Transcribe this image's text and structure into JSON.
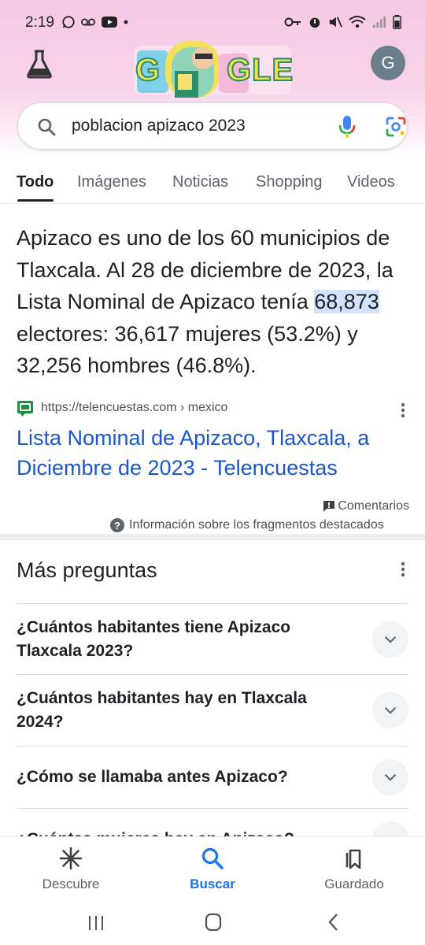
{
  "status_bar": {
    "time": "2:19",
    "left_icons": [
      "whatsapp-icon",
      "voicemail-icon",
      "youtube-icon",
      "dot-icon"
    ],
    "right_icons": [
      "key-icon",
      "alarm-icon",
      "mute-icon",
      "wifi-icon",
      "signal-icon",
      "battery-icon"
    ]
  },
  "header": {
    "labs_icon": "flask-icon",
    "doodle_text": "GLE",
    "avatar_letter": "G"
  },
  "search": {
    "query": "poblacion apizaco 2023"
  },
  "tabs": [
    "Todo",
    "Imágenes",
    "Noticias",
    "Shopping",
    "Videos"
  ],
  "featured_snippet": {
    "text_before": "Apizaco es uno de los 60 municipios de Tlaxcala. Al 28 de diciembre de 2023, la Lista Nominal de Apizaco tenía ",
    "highlight": "68,873",
    "text_after": " electores: 36,617 mujeres (53.2%) y 32,256 hombres (46.8%)."
  },
  "source": {
    "url": "https://telencuestas.com › mexico",
    "title": "Lista Nominal de Apizaco, Tlaxcala, a Diciembre de 2023 - Telencuestas"
  },
  "feedback": {
    "comments": "Comentarios",
    "info": "Información sobre los fragmentos destacados"
  },
  "people_also_ask": {
    "title": "Más preguntas",
    "questions": [
      "¿Cuántos habitantes tiene Apizaco Tlaxcala 2023?",
      "¿Cuántos habitantes hay en Tlaxcala 2024?",
      "¿Cómo se llamaba antes Apizaco?",
      "¿Cuántas mujeres hay en Apizaco?"
    ]
  },
  "bottom_nav": {
    "items": [
      {
        "label": "Descubre",
        "icon": "asterisk-icon"
      },
      {
        "label": "Buscar",
        "icon": "search-icon"
      },
      {
        "label": "Guardado",
        "icon": "bookmarks-icon"
      }
    ]
  },
  "colors": {
    "link_blue": "#1a58c9",
    "accent_blue": "#1a73e8",
    "header_pink": "#f6c9e4",
    "highlight": "#d3e3fd"
  }
}
